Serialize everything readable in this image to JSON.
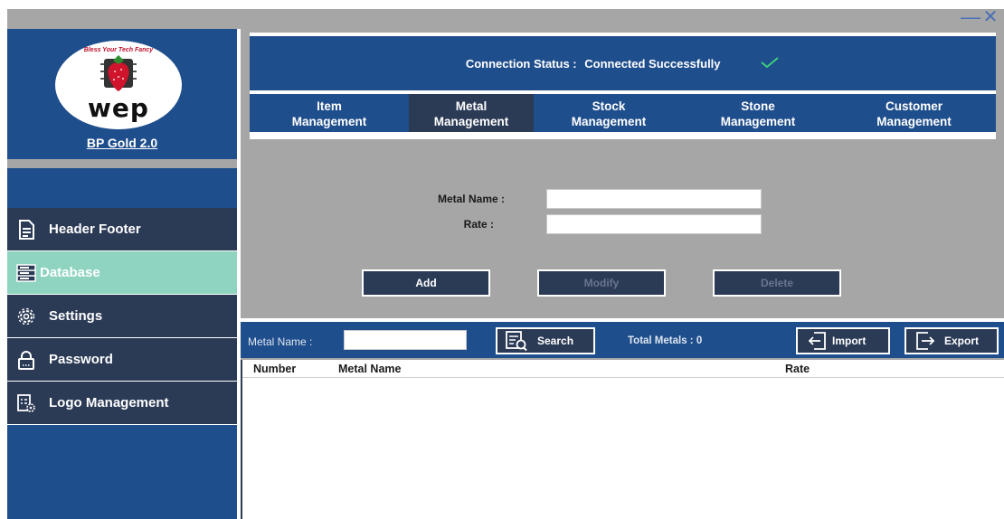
{
  "window": {
    "minimize_glyph": "—",
    "close_glyph": "✕"
  },
  "brand": {
    "logo_text": "wep",
    "logo_tagline": "Bless Your Tech Fancy",
    "app_name": "BP Gold 2.0"
  },
  "sidebar": {
    "items": [
      {
        "label": "Header Footer",
        "icon": "document-icon",
        "active": false
      },
      {
        "label": "Database",
        "icon": "database-icon",
        "active": true
      },
      {
        "label": "Settings",
        "icon": "gear-icon",
        "active": false
      },
      {
        "label": "Password",
        "icon": "lock-icon",
        "active": false
      },
      {
        "label": "Logo Management",
        "icon": "logo-settings-icon",
        "active": false
      }
    ]
  },
  "header": {
    "connection_label": "Connection Status :",
    "connection_value": "Connected Successfully",
    "tabs": [
      {
        "line1": "Item",
        "line2": "Management",
        "active": false
      },
      {
        "line1": "Metal",
        "line2": "Management",
        "active": true
      },
      {
        "line1": "Stock",
        "line2": "Management",
        "active": false
      },
      {
        "line1": "Stone",
        "line2": "Management",
        "active": false
      },
      {
        "line1": "Customer",
        "line2": "Management",
        "active": false
      }
    ]
  },
  "form": {
    "metal_name_label": "Metal Name :",
    "metal_name_value": "",
    "rate_label": "Rate :",
    "rate_value": "",
    "add_label": "Add",
    "modify_label": "Modify",
    "delete_label": "Delete"
  },
  "toolbar": {
    "search_label": "Metal Name :",
    "search_value": "",
    "search_button": "Search",
    "total_label": "Total Metals : 0",
    "import_button": "Import",
    "export_button": "Export"
  },
  "table": {
    "columns": [
      "Number",
      "Metal Name",
      "Rate"
    ],
    "rows": []
  },
  "colors": {
    "primary_blue": "#1f4e8c",
    "dark_navy": "#2b3a55",
    "active_teal": "#8fd4c1",
    "panel_gray": "#a6a6a6",
    "check_green": "#3dd47a"
  }
}
